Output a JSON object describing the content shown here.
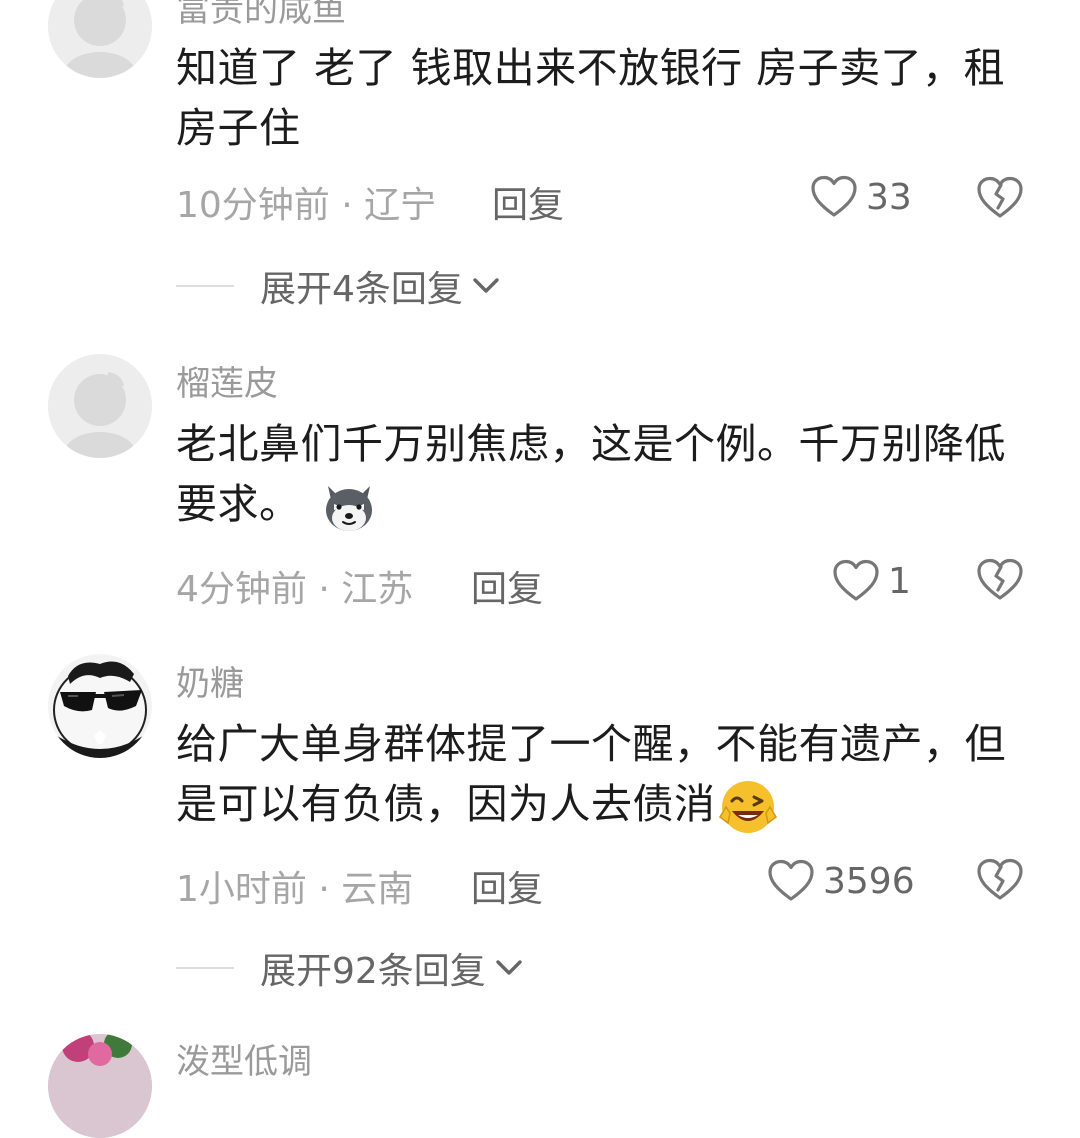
{
  "comments": [
    {
      "username": "富贵的咸鱼",
      "text": "知道了 老了 钱取出来不放银行 房子卖了，租房子住",
      "time": "10分钟前",
      "location": "辽宁",
      "meta_separator": " · ",
      "reply_label": "回复",
      "likes": "33",
      "avatar_icon": "default-avatar-icon",
      "expand_label": "展开4条回复"
    },
    {
      "username": "榴莲皮",
      "text": "老北鼻们千万别焦虑，这是个例。千万别降低要求。",
      "time": "4分钟前",
      "location": "江苏",
      "meta_separator": " · ",
      "reply_label": "回复",
      "likes": "1",
      "avatar_icon": "default-avatar-icon",
      "emoji": "husky-emoji-icon"
    },
    {
      "username": "奶糖",
      "text": "给广大单身群体提了一个醒，不能有遗产，但是可以有负债，因为人去债消",
      "time": "1小时前",
      "location": "云南",
      "meta_separator": " · ",
      "reply_label": "回复",
      "likes": "3596",
      "avatar_icon": "sunglasses-avatar-icon",
      "emoji": "grinning-wink-emoji-icon",
      "expand_label": "展开92条回复"
    },
    {
      "username": "泼型低调",
      "avatar_icon": "flower-avatar-icon"
    }
  ],
  "colors": {
    "meta": "#a6a6a6",
    "action": "#666666",
    "text": "#1c1c1c",
    "background": "#ffffff"
  }
}
